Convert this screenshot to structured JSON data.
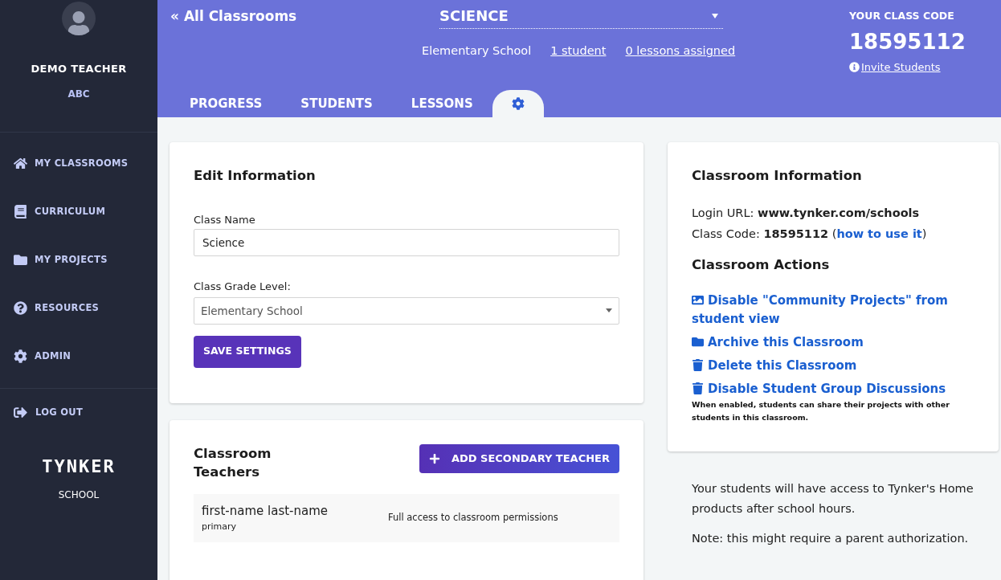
{
  "sidebar": {
    "user_name": "DEMO TEACHER",
    "user_org": "ABC",
    "items": [
      {
        "label": "MY CLASSROOMS",
        "kind": "home"
      },
      {
        "label": "CURRICULUM",
        "kind": "books"
      },
      {
        "label": "MY PROJECTS",
        "kind": "folder"
      },
      {
        "label": "RESOURCES",
        "kind": "question"
      },
      {
        "label": "ADMIN",
        "kind": "gear"
      }
    ],
    "logout": "LOG OUT",
    "logo": "TYNKER",
    "logo_sub": "SCHOOL"
  },
  "header": {
    "back_link": "« All Classrooms",
    "class_select": "SCIENCE",
    "grade": "Elementary School",
    "students_link": "1 student",
    "lessons_link": "0 lessons assigned",
    "code_label": "YOUR CLASS CODE",
    "code": "18595112",
    "invite_link": "Invite Students",
    "tabs": [
      {
        "kind": "text",
        "label": "PROGRESS",
        "selected": false
      },
      {
        "kind": "text",
        "label": "STUDENTS",
        "selected": false
      },
      {
        "kind": "text",
        "label": "LESSONS",
        "selected": false
      },
      {
        "kind": "gear",
        "selected": true
      }
    ]
  },
  "edit": {
    "title": "Edit Information",
    "name_label": "Class Name",
    "name_value": "Science",
    "grade_label": "Class Grade Level:",
    "grade_value": "Elementary School",
    "save": "SAVE SETTINGS"
  },
  "teachers": {
    "title": "Classroom Teachers",
    "add": "ADD SECONDARY TEACHER",
    "rows": [
      {
        "name": "first-name last-name",
        "role": "primary",
        "access": "Full access to classroom permissions"
      }
    ]
  },
  "info": {
    "title": "Classroom Information",
    "login_label": "Login URL:",
    "login_url": "www.tynker.com/schools",
    "code_label": "Class Code:",
    "code": "18595112",
    "how_open": "(",
    "how_link": "how to use it",
    "how_close": ")",
    "actions_title": "Classroom Actions",
    "actions": [
      {
        "kind": "image",
        "label": "Disable \"Community Projects\" from student view"
      },
      {
        "kind": "folder",
        "label": "Archive this Classroom"
      },
      {
        "kind": "trash",
        "label": "Delete this Classroom"
      },
      {
        "kind": "trash",
        "label": "Disable Student Group Discussions"
      }
    ],
    "actions_note": "When enabled, students can share their projects with other students in this classroom."
  },
  "notes": [
    "Your students will have access to Tynker's Home products after school hours.",
    "Note: this might require a parent authorization."
  ]
}
